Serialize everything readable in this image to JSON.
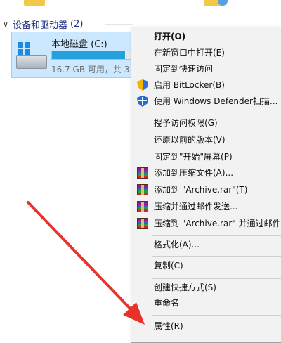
{
  "explorer": {
    "group_title": "设备和驱动器",
    "group_count": "(2)",
    "drive": {
      "name": "本地磁盘 (C:)",
      "space_text": "16.7 GB 可用，共 3",
      "used_fraction": 0.85
    }
  },
  "context_menu": {
    "items": [
      {
        "label": "打开(O)",
        "bold": true,
        "icon": ""
      },
      {
        "label": "在新窗口中打开(E)",
        "icon": ""
      },
      {
        "label": "固定到快速访问",
        "icon": ""
      },
      {
        "label": "启用 BitLocker(B)",
        "icon": "bitlocker-shield-icon"
      },
      {
        "label": "使用 Windows Defender扫描...",
        "icon": "windows-defender-icon"
      },
      {
        "label": "授予访问权限(G)",
        "icon": ""
      },
      {
        "label": "还原以前的版本(V)",
        "icon": ""
      },
      {
        "label": "固定到\"开始\"屏幕(P)",
        "icon": ""
      },
      {
        "label": "添加到压缩文件(A)...",
        "icon": "winrar-icon"
      },
      {
        "label": "添加到 \"Archive.rar\"(T)",
        "icon": "winrar-icon"
      },
      {
        "label": "压缩并通过邮件发送...",
        "icon": "winrar-icon"
      },
      {
        "label": "压缩到 \"Archive.rar\" 并通过邮件发送",
        "icon": "winrar-icon"
      },
      {
        "label": "格式化(A)...",
        "icon": ""
      },
      {
        "label": "复制(C)",
        "icon": ""
      },
      {
        "label": "创建快捷方式(S)",
        "icon": ""
      },
      {
        "label": "重命名",
        "icon": ""
      },
      {
        "label": "属性(R)",
        "icon": ""
      }
    ]
  },
  "colors": {
    "selection_bg": "#cce8ff",
    "menu_bg": "#f2f2f2",
    "annotation_arrow": "#e8322c"
  }
}
